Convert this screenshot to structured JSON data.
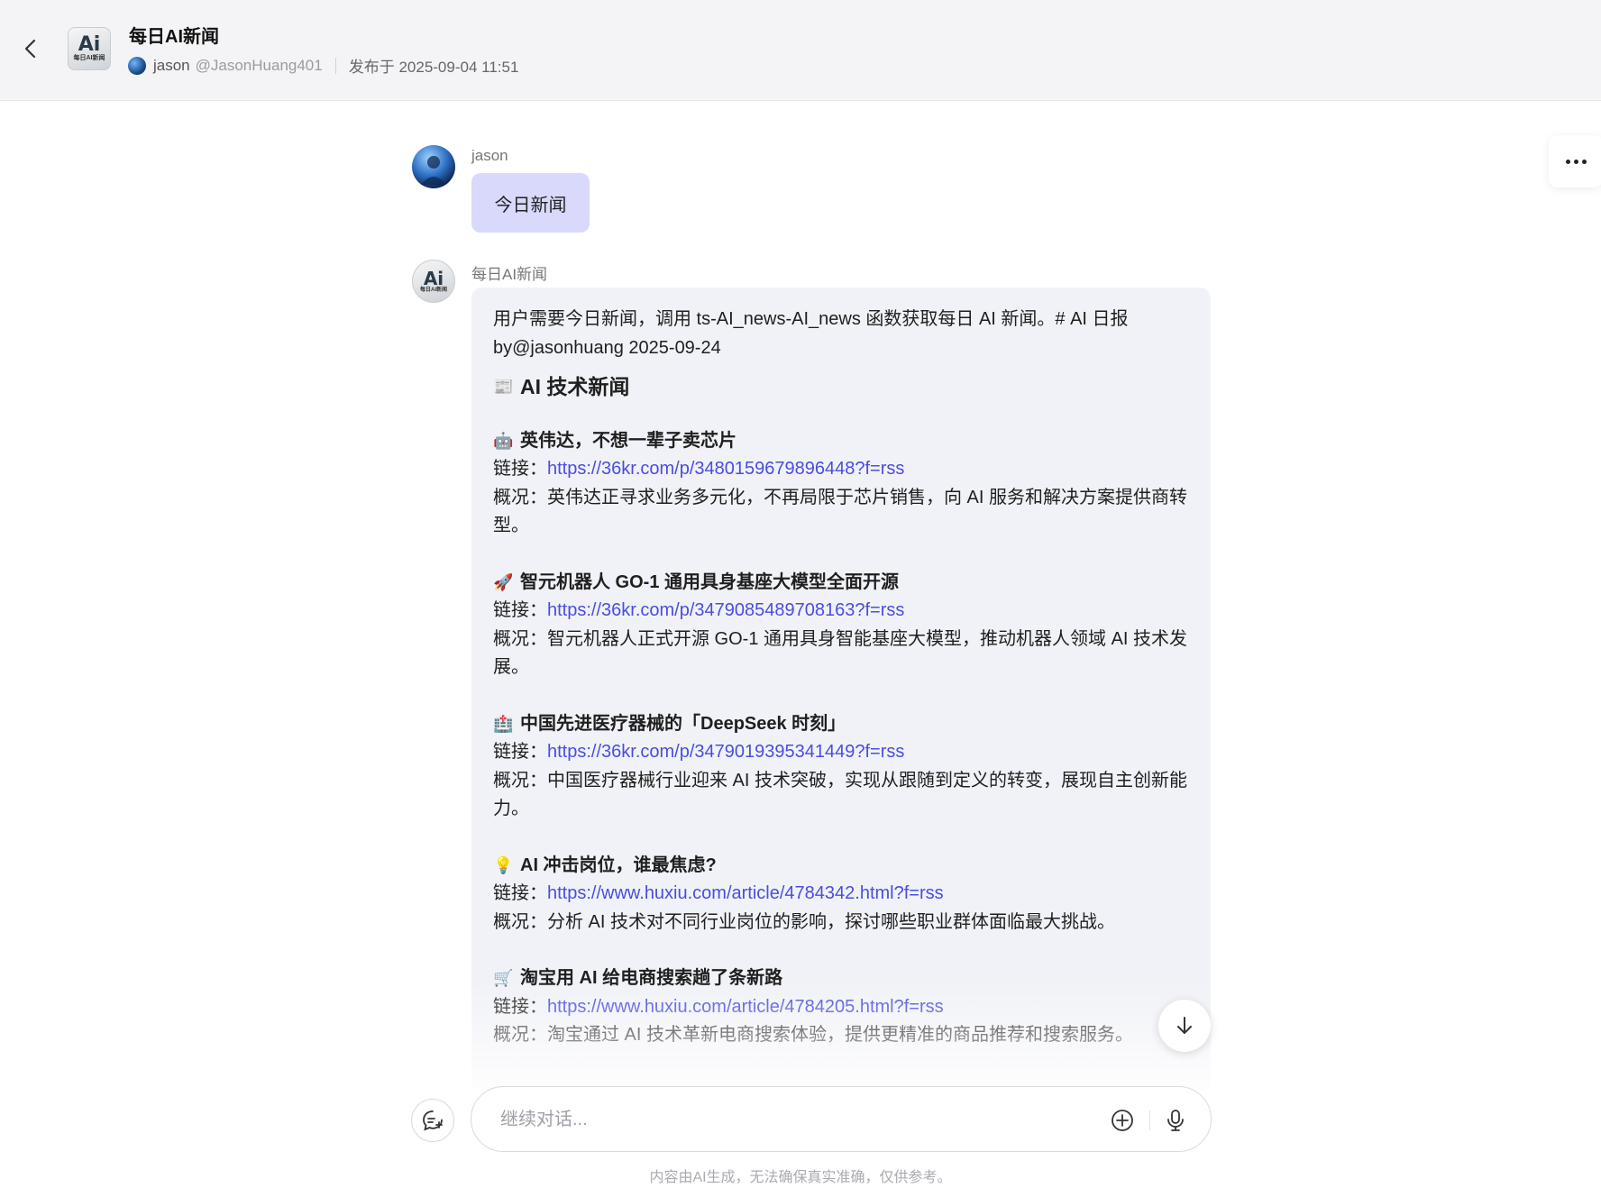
{
  "header": {
    "back_icon": "chevron-left-icon",
    "logo_text": "Ai",
    "logo_sub": "每日AI新闻",
    "title": "每日AI新闻",
    "author_name": "jason",
    "author_handle": "@JasonHuang401",
    "published": "发布于 2025-09-04 11:51"
  },
  "more_icon": "more-horizontal-icon",
  "user_message": {
    "name": "jason",
    "text": "今日新闻"
  },
  "bot_message": {
    "name": "每日AI新闻",
    "intro": "用户需要今日新闻，调用 ts-AI_news-AI_news 函数获取每日 AI 新闻。# AI 日报 by@jasonhuang 2025-09-24",
    "section_emoji": "📰",
    "section_title": "AI 技术新闻",
    "link_label": "链接：",
    "summary_label": "概况：",
    "items": [
      {
        "emoji": "🤖",
        "title": "英伟达，不想一辈子卖芯片",
        "link": "https://36kr.com/p/3480159679896448?f=rss",
        "summary": "英伟达正寻求业务多元化，不再局限于芯片销售，向 AI 服务和解决方案提供商转型。"
      },
      {
        "emoji": "🚀",
        "title": "智元机器人 GO-1 通用具身基座大模型全面开源",
        "link": "https://36kr.com/p/3479085489708163?f=rss",
        "summary": "智元机器人正式开源 GO-1 通用具身智能基座大模型，推动机器人领域 AI 技术发展。"
      },
      {
        "emoji": "🏥",
        "title": "中国先进医疗器械的「DeepSeek 时刻」",
        "link": "https://36kr.com/p/3479019395341449?f=rss",
        "summary": "中国医疗器械行业迎来 AI 技术突破，实现从跟随到定义的转变，展现自主创新能力。"
      },
      {
        "emoji": "💡",
        "title": "AI 冲击岗位，谁最焦虑?",
        "link": "https://www.huxiu.com/article/4784342.html?f=rss",
        "summary": "分析 AI 技术对不同行业岗位的影响，探讨哪些职业群体面临最大挑战。"
      },
      {
        "emoji": "🛒",
        "title": "淘宝用 AI 给电商搜索趟了条新路",
        "link": "https://www.huxiu.com/article/4784205.html?f=rss",
        "summary": "淘宝通过 AI 技术革新电商搜索体验，提供更精准的商品推荐和搜索服务。"
      }
    ]
  },
  "scroll_down_icon": "arrow-down-icon",
  "composer": {
    "new_chat_icon": "new-chat-icon",
    "placeholder": "继续对话...",
    "value": "",
    "plus_icon": "plus-circle-icon",
    "mic_icon": "microphone-icon"
  },
  "disclaimer": "内容由AI生成，无法确保真实准确，仅供参考。"
}
